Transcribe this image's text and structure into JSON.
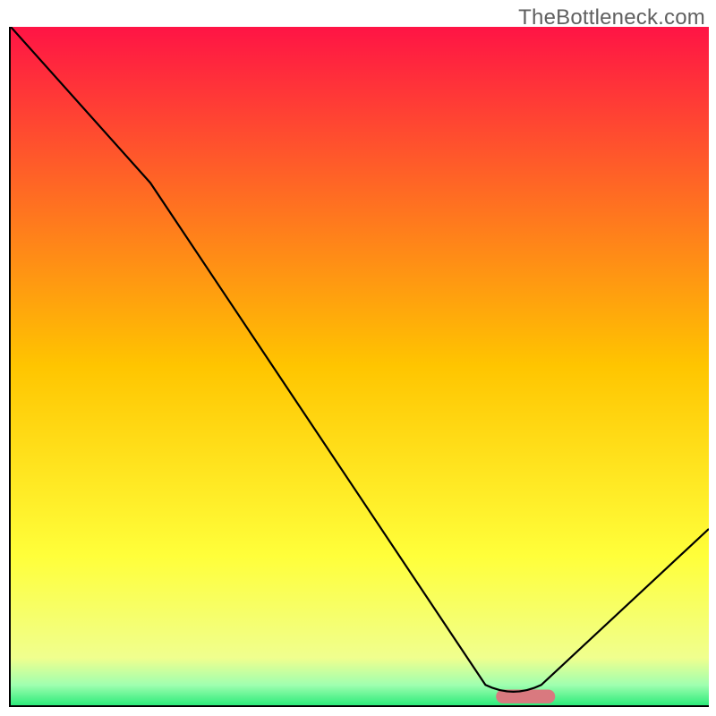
{
  "watermark": "TheBottleneck.com",
  "chart_data": {
    "type": "line",
    "title": "",
    "xlabel": "",
    "ylabel": "",
    "xlim": [
      0,
      100
    ],
    "ylim": [
      0,
      100
    ],
    "x": [
      0,
      20,
      68,
      72,
      76,
      100
    ],
    "values": [
      100,
      77,
      3,
      2,
      3,
      26
    ],
    "background_gradient_stops": [
      {
        "offset": 0,
        "color": "#ff1445"
      },
      {
        "offset": 50,
        "color": "#ffc500"
      },
      {
        "offset": 78,
        "color": "#ffff3a"
      },
      {
        "offset": 93,
        "color": "#f0ff8e"
      },
      {
        "offset": 97,
        "color": "#a0ffb0"
      },
      {
        "offset": 100,
        "color": "#2deb7a"
      }
    ],
    "marker": {
      "x_left": 70.5,
      "x_right": 77,
      "y": 1.3,
      "color": "#d9797f",
      "thickness": 2.2
    }
  }
}
